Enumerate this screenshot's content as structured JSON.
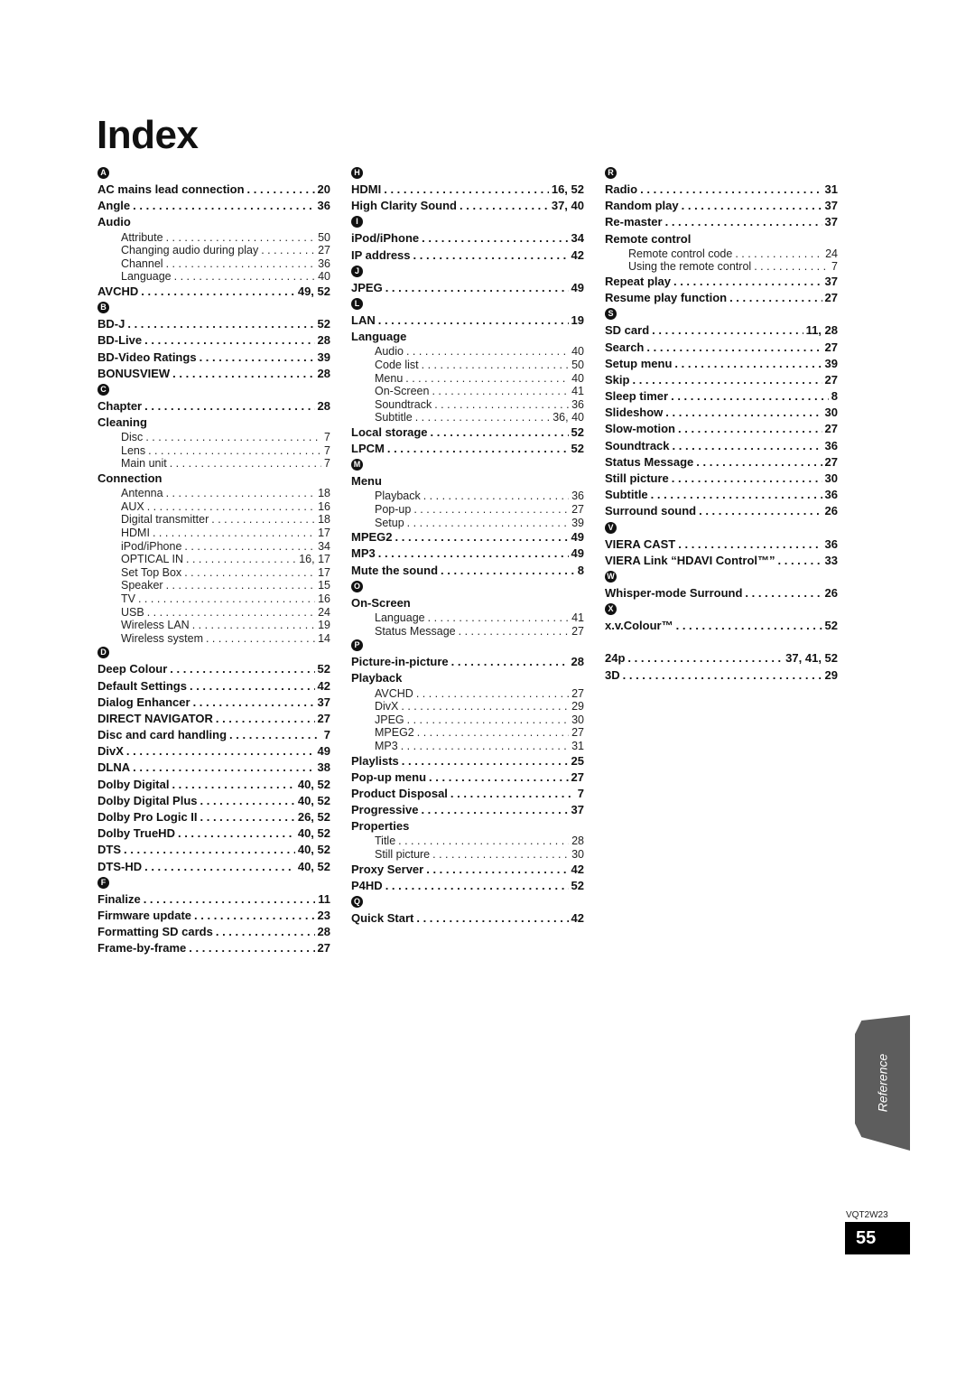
{
  "page_title": "Index",
  "columns": [
    [
      {
        "type": "letter",
        "text": "A"
      },
      {
        "type": "main",
        "label": "AC mains lead connection",
        "page": "20"
      },
      {
        "type": "main",
        "label": "Angle",
        "page": "36"
      },
      {
        "type": "head",
        "label": "Audio"
      },
      {
        "type": "sub",
        "label": "Attribute",
        "page": "50"
      },
      {
        "type": "sub",
        "label": "Changing audio during play",
        "page": "27"
      },
      {
        "type": "sub",
        "label": "Channel",
        "page": "36"
      },
      {
        "type": "sub",
        "label": "Language",
        "page": "40"
      },
      {
        "type": "main",
        "label": "AVCHD",
        "page": "49, 52"
      },
      {
        "type": "letter",
        "text": "B"
      },
      {
        "type": "main",
        "label": "BD-J",
        "page": "52"
      },
      {
        "type": "main",
        "label": "BD-Live",
        "page": "28"
      },
      {
        "type": "main",
        "label": "BD-Video Ratings",
        "page": "39"
      },
      {
        "type": "main",
        "label": "BONUSVIEW",
        "page": "28"
      },
      {
        "type": "letter",
        "text": "C"
      },
      {
        "type": "main",
        "label": "Chapter",
        "page": "28"
      },
      {
        "type": "head",
        "label": "Cleaning"
      },
      {
        "type": "sub",
        "label": "Disc",
        "page": "7"
      },
      {
        "type": "sub",
        "label": "Lens",
        "page": "7"
      },
      {
        "type": "sub",
        "label": "Main unit",
        "page": "7"
      },
      {
        "type": "head",
        "label": "Connection"
      },
      {
        "type": "sub",
        "label": "Antenna",
        "page": "18"
      },
      {
        "type": "sub",
        "label": "AUX",
        "page": "16"
      },
      {
        "type": "sub",
        "label": "Digital transmitter",
        "page": "18"
      },
      {
        "type": "sub",
        "label": "HDMI",
        "page": "17"
      },
      {
        "type": "sub",
        "label": "iPod/iPhone",
        "page": "34"
      },
      {
        "type": "sub",
        "label": "OPTICAL IN",
        "page": "16, 17"
      },
      {
        "type": "sub",
        "label": "Set Top Box",
        "page": "17"
      },
      {
        "type": "sub",
        "label": "Speaker",
        "page": "15"
      },
      {
        "type": "sub",
        "label": "TV",
        "page": "16"
      },
      {
        "type": "sub",
        "label": "USB",
        "page": "24"
      },
      {
        "type": "sub",
        "label": "Wireless LAN",
        "page": "19"
      },
      {
        "type": "sub",
        "label": "Wireless system",
        "page": "14"
      },
      {
        "type": "letter",
        "text": "D"
      },
      {
        "type": "main",
        "label": "Deep Colour",
        "page": "52"
      },
      {
        "type": "main",
        "label": "Default Settings",
        "page": "42"
      },
      {
        "type": "main",
        "label": "Dialog Enhancer",
        "page": "37"
      },
      {
        "type": "main",
        "label": "DIRECT NAVIGATOR",
        "page": "27"
      },
      {
        "type": "main",
        "label": "Disc and card handling",
        "page": "7"
      },
      {
        "type": "main",
        "label": "DivX",
        "page": "49"
      },
      {
        "type": "main",
        "label": "DLNA",
        "page": "38"
      },
      {
        "type": "main",
        "label": "Dolby Digital",
        "page": "40, 52"
      },
      {
        "type": "main",
        "label": "Dolby Digital Plus",
        "page": "40, 52"
      },
      {
        "type": "main",
        "label": "Dolby Pro Logic II",
        "page": "26, 52"
      },
      {
        "type": "main",
        "label": "Dolby TrueHD",
        "page": "40, 52"
      },
      {
        "type": "main",
        "label": "DTS",
        "page": "40, 52"
      },
      {
        "type": "main",
        "label": "DTS-HD",
        "page": "40, 52"
      },
      {
        "type": "letter",
        "text": "F"
      },
      {
        "type": "main",
        "label": "Finalize",
        "page": "11"
      },
      {
        "type": "main",
        "label": "Firmware update",
        "page": "23"
      },
      {
        "type": "main",
        "label": "Formatting SD cards",
        "page": "28"
      },
      {
        "type": "main",
        "label": "Frame-by-frame",
        "page": "27"
      }
    ],
    [
      {
        "type": "letter",
        "text": "H"
      },
      {
        "type": "main",
        "label": "HDMI",
        "page": "16, 52"
      },
      {
        "type": "main",
        "label": "High Clarity Sound",
        "page": "37, 40"
      },
      {
        "type": "letter",
        "text": "I"
      },
      {
        "type": "main",
        "label": "iPod/iPhone",
        "page": "34"
      },
      {
        "type": "main",
        "label": "IP address",
        "page": "42"
      },
      {
        "type": "letter",
        "text": "J"
      },
      {
        "type": "main",
        "label": "JPEG",
        "page": "49"
      },
      {
        "type": "letter",
        "text": "L"
      },
      {
        "type": "main",
        "label": "LAN",
        "page": "19"
      },
      {
        "type": "head",
        "label": "Language"
      },
      {
        "type": "sub",
        "label": "Audio",
        "page": "40"
      },
      {
        "type": "sub",
        "label": "Code list",
        "page": "50"
      },
      {
        "type": "sub",
        "label": "Menu",
        "page": "40"
      },
      {
        "type": "sub",
        "label": "On-Screen",
        "page": "41"
      },
      {
        "type": "sub",
        "label": "Soundtrack",
        "page": "36"
      },
      {
        "type": "sub",
        "label": "Subtitle",
        "page": "36, 40"
      },
      {
        "type": "main",
        "label": "Local storage",
        "page": "52"
      },
      {
        "type": "main",
        "label": "LPCM",
        "page": "52"
      },
      {
        "type": "letter",
        "text": "M"
      },
      {
        "type": "head",
        "label": "Menu"
      },
      {
        "type": "sub",
        "label": "Playback",
        "page": "36"
      },
      {
        "type": "sub",
        "label": "Pop-up",
        "page": "27"
      },
      {
        "type": "sub",
        "label": "Setup",
        "page": "39"
      },
      {
        "type": "main",
        "label": "MPEG2",
        "page": "49"
      },
      {
        "type": "main",
        "label": "MP3",
        "page": "49"
      },
      {
        "type": "main",
        "label": "Mute the sound",
        "page": "8"
      },
      {
        "type": "letter",
        "text": "O"
      },
      {
        "type": "head",
        "label": "On-Screen"
      },
      {
        "type": "sub",
        "label": "Language",
        "page": "41"
      },
      {
        "type": "sub",
        "label": "Status Message",
        "page": "27"
      },
      {
        "type": "letter",
        "text": "P"
      },
      {
        "type": "main",
        "label": "Picture-in-picture",
        "page": "28"
      },
      {
        "type": "head",
        "label": "Playback"
      },
      {
        "type": "sub",
        "label": "AVCHD",
        "page": "27"
      },
      {
        "type": "sub",
        "label": "DivX",
        "page": "29"
      },
      {
        "type": "sub",
        "label": "JPEG",
        "page": "30"
      },
      {
        "type": "sub",
        "label": "MPEG2",
        "page": "27"
      },
      {
        "type": "sub",
        "label": "MP3",
        "page": "31"
      },
      {
        "type": "main",
        "label": "Playlists",
        "page": "25"
      },
      {
        "type": "main",
        "label": "Pop-up menu",
        "page": "27"
      },
      {
        "type": "main",
        "label": "Product Disposal",
        "page": "7"
      },
      {
        "type": "main",
        "label": "Progressive",
        "page": "37"
      },
      {
        "type": "head",
        "label": "Properties"
      },
      {
        "type": "sub",
        "label": "Title",
        "page": "28"
      },
      {
        "type": "sub",
        "label": "Still picture",
        "page": "30"
      },
      {
        "type": "main",
        "label": "Proxy Server",
        "page": "42"
      },
      {
        "type": "main",
        "label": "P4HD",
        "page": "52"
      },
      {
        "type": "letter",
        "text": "Q"
      },
      {
        "type": "main",
        "label": "Quick Start",
        "page": "42"
      }
    ],
    [
      {
        "type": "letter",
        "text": "R"
      },
      {
        "type": "main",
        "label": "Radio",
        "page": "31"
      },
      {
        "type": "main",
        "label": "Random play",
        "page": "37"
      },
      {
        "type": "main",
        "label": "Re-master",
        "page": "37"
      },
      {
        "type": "head",
        "label": "Remote control"
      },
      {
        "type": "sub",
        "label": "Remote control code",
        "page": "24"
      },
      {
        "type": "sub",
        "label": "Using the remote control",
        "page": "7"
      },
      {
        "type": "main",
        "label": "Repeat play",
        "page": "37"
      },
      {
        "type": "main",
        "label": "Resume play function",
        "page": "27"
      },
      {
        "type": "letter",
        "text": "S"
      },
      {
        "type": "main",
        "label": "SD card",
        "page": "11, 28"
      },
      {
        "type": "main",
        "label": "Search",
        "page": "27"
      },
      {
        "type": "main",
        "label": "Setup menu",
        "page": "39"
      },
      {
        "type": "main",
        "label": "Skip",
        "page": "27"
      },
      {
        "type": "main",
        "label": "Sleep timer",
        "page": "8"
      },
      {
        "type": "main",
        "label": "Slideshow",
        "page": "30"
      },
      {
        "type": "main",
        "label": "Slow-motion",
        "page": "27"
      },
      {
        "type": "main",
        "label": "Soundtrack",
        "page": "36"
      },
      {
        "type": "main",
        "label": "Status Message",
        "page": "27"
      },
      {
        "type": "main",
        "label": "Still picture",
        "page": "30"
      },
      {
        "type": "main",
        "label": "Subtitle",
        "page": "36"
      },
      {
        "type": "main",
        "label": "Surround sound",
        "page": "26"
      },
      {
        "type": "letter",
        "text": "V"
      },
      {
        "type": "main",
        "label": "VIERA CAST",
        "page": "36"
      },
      {
        "type": "main",
        "label": "VIERA Link “HDAVI Control™”",
        "page": "33"
      },
      {
        "type": "letter",
        "text": "W"
      },
      {
        "type": "main",
        "label": "Whisper-mode Surround",
        "page": "26"
      },
      {
        "type": "letter",
        "text": "X"
      },
      {
        "type": "main",
        "label": "x.v.Colour™",
        "page": "52"
      },
      {
        "type": "gap"
      },
      {
        "type": "main",
        "label": "24p",
        "page": "37, 41, 52"
      },
      {
        "type": "main",
        "label": "3D",
        "page": "29"
      }
    ]
  ],
  "side_tab": {
    "label": "Reference"
  },
  "footer": {
    "model_code": "VQT2W23",
    "page_number": "55"
  }
}
